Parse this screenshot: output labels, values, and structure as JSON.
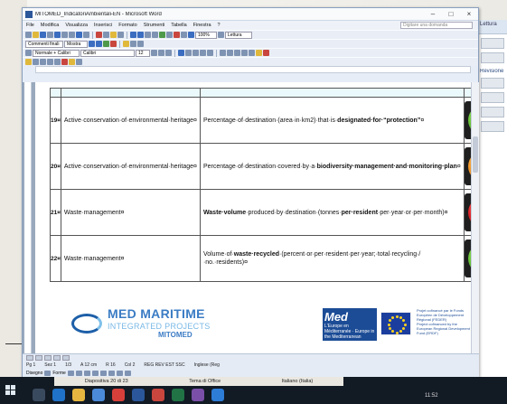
{
  "window": {
    "title": "MITOMED_IndicatoriAmbientali-EN - Microsoft Word",
    "minimize": "–",
    "maximize": "□",
    "close": "×"
  },
  "menu": {
    "items": [
      "File",
      "Modifica",
      "Visualizza",
      "Inserisci",
      "Formato",
      "Strumenti",
      "Tabella",
      "Finestra",
      "?"
    ],
    "help_placeholder": "Digitare una domanda"
  },
  "toolbar": {
    "zoom": "100%",
    "reading": "Lettura",
    "style": "Normale + Calibri",
    "font": "Calibri",
    "size": "12",
    "comments": "Commenti finali",
    "show": "Mostra"
  },
  "table": {
    "rows": [
      {
        "num": "19¤",
        "area": "Active·conservation·of·environmental·heritage¤",
        "indicator_parts": [
          {
            "text": "Percentage·of·destination·(area·in·km2)·that·is·",
            "bold": false
          },
          {
            "text": "designated·for·“protection”",
            "bold": true
          },
          {
            "text": "¤",
            "bold": false
          }
        ],
        "lights": [
          "green",
          "green",
          "orange",
          "green"
        ]
      },
      {
        "num": "20¤",
        "area": "Active·conservation·of·environmental·heritage¤",
        "indicator_parts": [
          {
            "text": "Percentage·of·destination·covered·by·a·",
            "bold": false
          },
          {
            "text": "biodiversity·management·and·monitoring·plan",
            "bold": true
          },
          {
            "text": "¤",
            "bold": false
          }
        ],
        "lights": [
          "orange",
          "red",
          "",
          "green"
        ]
      },
      {
        "num": "21¤",
        "area": "Waste·management¤",
        "indicator_parts": [
          {
            "text": "Waste·volume",
            "bold": true
          },
          {
            "text": "·produced·by·destination·(tonnes·",
            "bold": false
          },
          {
            "text": "per·resident",
            "bold": true
          },
          {
            "text": "·per·year·or·per·month)¤",
            "bold": false
          }
        ],
        "lights": [
          "red",
          "green",
          "red",
          "red"
        ]
      },
      {
        "num": "22¤",
        "area": "Waste·management¤",
        "indicator_parts": [
          {
            "text": "Volume·of·",
            "bold": false
          },
          {
            "text": "waste·recycled",
            "bold": true
          },
          {
            "text": "·(percent·or·per·resident·per·year;·total·recycling·/·no.·residents)¤",
            "bold": false
          }
        ],
        "lights": [
          "green",
          "green",
          "red",
          "green"
        ]
      }
    ],
    "empty_mark": "¤"
  },
  "footer_logo": {
    "line1": "MED MARITIME",
    "line2": "INTEGRATED PROJECTS",
    "line3": "MITOMED"
  },
  "eu": {
    "med_small": "L'Europe en Méditerranée · Europe in the Mediterranean",
    "med_big": "Med",
    "text1": "Projet cofinancé par le Fonds Européen de Développement Régional (FEDER)",
    "text2": "Project cofinanced by the European Regional Development Fund (ERDF)"
  },
  "status": {
    "page": "Pg   1",
    "sec": "Sez   1",
    "pages": "1/3",
    "at": "A  12 cm",
    "line": "R   16",
    "col": "Col  2",
    "flags": "REG  REV  EST  SSC",
    "lang": "Inglese (Reg",
    "draw": "Disegno",
    "shapes": "Forme"
  },
  "taskbar": {
    "info_items": [
      "Diapositiva 20 di 23",
      "Tema di Office",
      "Italiano (Italia)"
    ],
    "clock": "11:52"
  },
  "background_window": {
    "label1": "Lettura",
    "label2": "Revisione"
  }
}
